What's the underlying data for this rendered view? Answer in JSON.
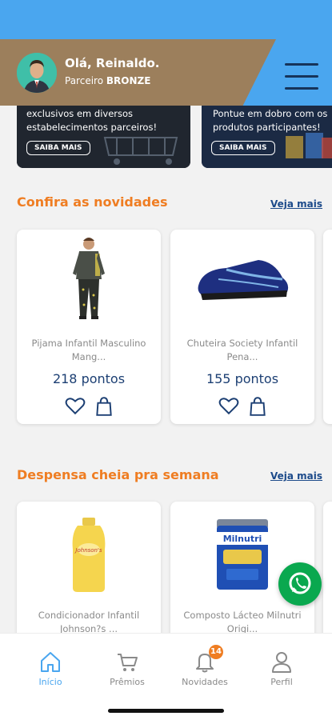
{
  "header": {
    "greeting": "Olá, Reinaldo.",
    "tier_prefix": "Parceiro",
    "tier_name": "BRONZE",
    "colors": {
      "top_bg": "#4aa6ef",
      "profile_bg": "#9c7f5c",
      "menu_icon": "#16345a"
    }
  },
  "banners": [
    {
      "text": "exclusivos em diversos estabelecimentos parceiros!",
      "button": "SAIBA MAIS"
    },
    {
      "text": "Pontue em dobro com os produtos participantes!",
      "button": "SAIBA MAIS"
    }
  ],
  "sections": [
    {
      "title": "Confira as novidades",
      "see_more": "Veja mais",
      "products": [
        {
          "name": "Pijama Infantil Masculino Mang...",
          "points": "218 pontos",
          "image": "kids-pajama"
        },
        {
          "name": "Chuteira Society Infantil Pena...",
          "points": "155 pontos",
          "image": "soccer-shoe"
        }
      ]
    },
    {
      "title": "Despensa cheia pra semana",
      "see_more": "Veja mais",
      "products": [
        {
          "name": "Condicionador Infantil Johnson?s ...",
          "image": "conditioner-bottle",
          "image_text": "Johnson's"
        },
        {
          "name": "Composto Lácteo Milnutri Origi...",
          "image": "milk-can",
          "image_text": "Milnutri"
        }
      ]
    }
  ],
  "bottom_nav": [
    {
      "label": "Início",
      "icon": "home-icon",
      "active": true
    },
    {
      "label": "Prêmios",
      "icon": "cart-icon"
    },
    {
      "label": "Novidades",
      "icon": "bell-icon",
      "badge": "14"
    },
    {
      "label": "Perfil",
      "icon": "user-icon"
    }
  ],
  "colors": {
    "accent_orange": "#ef7d22",
    "points_blue": "#1c3f73",
    "whatsapp_green": "#0aa84f",
    "active_nav": "#4aa6ef"
  }
}
